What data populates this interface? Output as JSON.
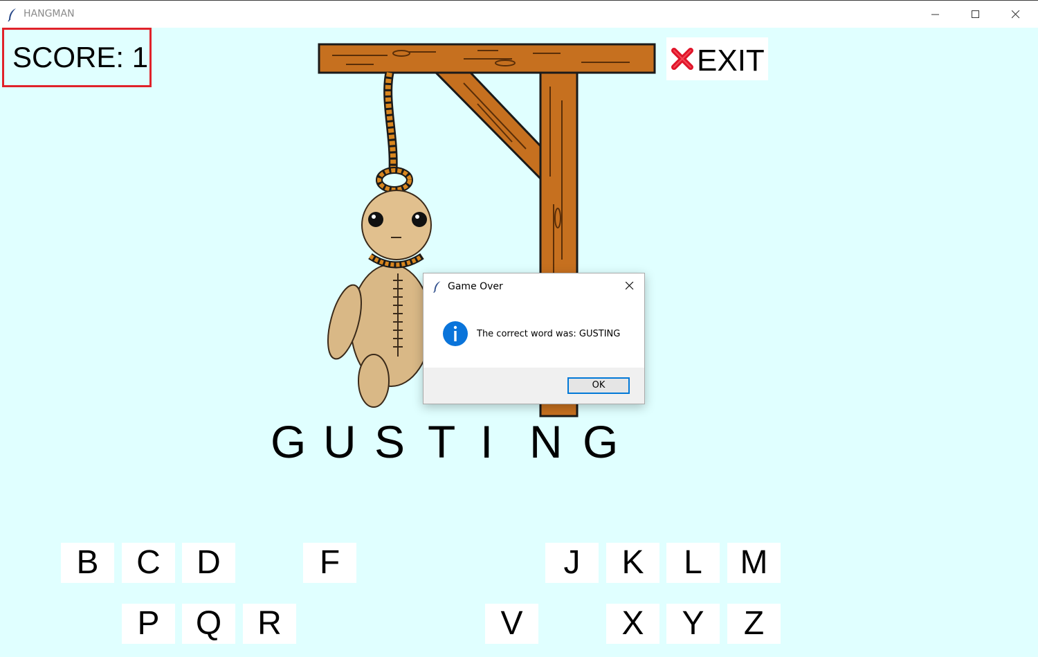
{
  "window": {
    "title": "HANGMAN",
    "icons": [
      "feather-icon",
      "minimize-icon",
      "maximize-icon",
      "close-icon"
    ]
  },
  "score": {
    "label": "SCORE: 1"
  },
  "exit_button": {
    "label": "EXIT",
    "icon": "red-x-icon"
  },
  "word": {
    "letters": [
      "G",
      "U",
      "S",
      "T",
      "I",
      "N",
      "G"
    ]
  },
  "keyboard": {
    "row1": [
      "B",
      "C",
      "D",
      "F",
      "J",
      "K",
      "L",
      "M"
    ],
    "row2": [
      "P",
      "Q",
      "R",
      "V",
      "X",
      "Y",
      "Z"
    ]
  },
  "dialog": {
    "title": "Game Over",
    "message": "The correct word was: GUSTING",
    "ok_label": "OK",
    "icon": "info-icon"
  },
  "colors": {
    "background": "#e0ffff",
    "score_border": "#e0222a",
    "wood": "#c6701f",
    "info_blue": "#0a74da",
    "ok_border": "#0078d7"
  }
}
